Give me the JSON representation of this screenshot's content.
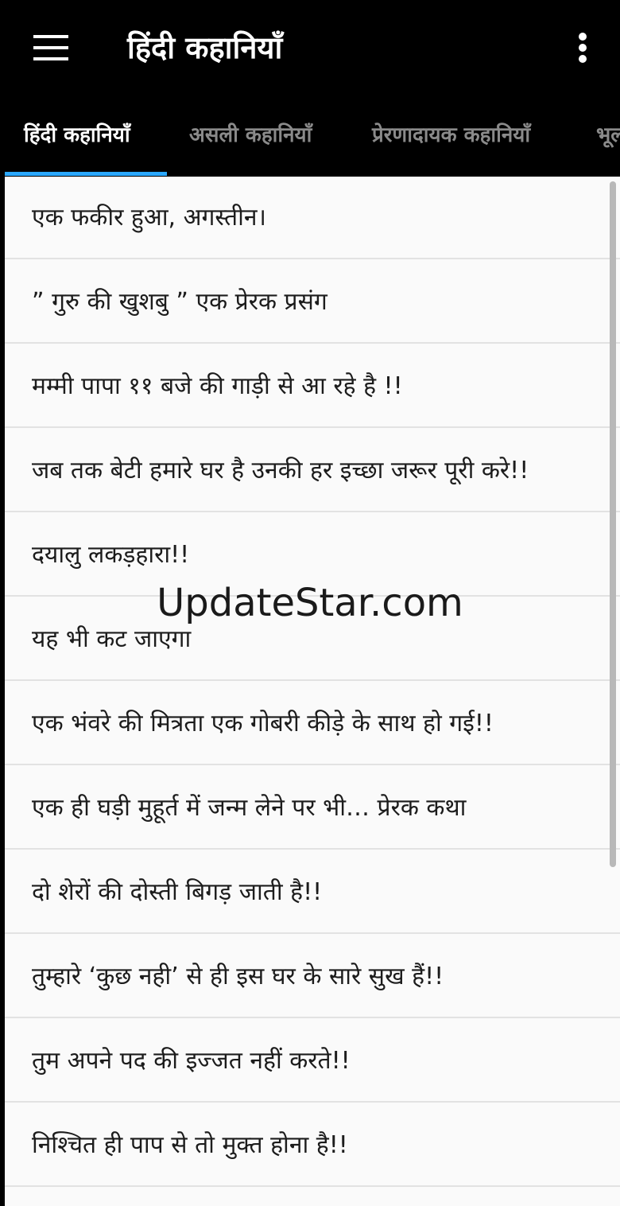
{
  "appbar": {
    "title": "हिंदी कहानियाँ",
    "menu_icon": "hamburger-menu-icon",
    "more_icon": "more-vertical-icon"
  },
  "tabs": [
    {
      "label": "हिंदी कहानियाँ",
      "active": true
    },
    {
      "label": "असली कहानियाँ",
      "active": false
    },
    {
      "label": "प्रेरणादायक कहानियाँ",
      "active": false
    },
    {
      "label": "भूल",
      "active": false
    }
  ],
  "stories": [
    "एक फकीर हुआ, अगस्तीन।",
    "” गुरु की खुशबु ” एक प्रेरक प्रसंग",
    "मम्मी पापा ११ बजे की गाड़ी से आ रहे है !!",
    "जब तक बेटी हमारे घर है उनकी हर इच्छा जरूर पूरी करे!!",
    "दयालु लकड़हारा!!",
    "यह भी कट जाएगा",
    "एक भंवरे की मित्रता एक गोबरी कीड़े के साथ हो गई!!",
    "एक ही घड़ी मुहूर्त में जन्म लेने पर भी… प्रेरक कथा",
    "दो शेरों की दोस्ती बिगड़ जाती है!!",
    "तुम्हारे ‘कुछ नही’ से ही इस घर के सारे सुख हैं!!",
    "तुम अपने पद की इज्जत नहीं करते!!",
    "निश्चित ही पाप से तो मुक्त होना है!!"
  ],
  "watermark": "UpdateStar.com",
  "colors": {
    "appbar_bg": "#000000",
    "tab_indicator": "#2ba8ff",
    "list_bg": "#fafafa"
  }
}
